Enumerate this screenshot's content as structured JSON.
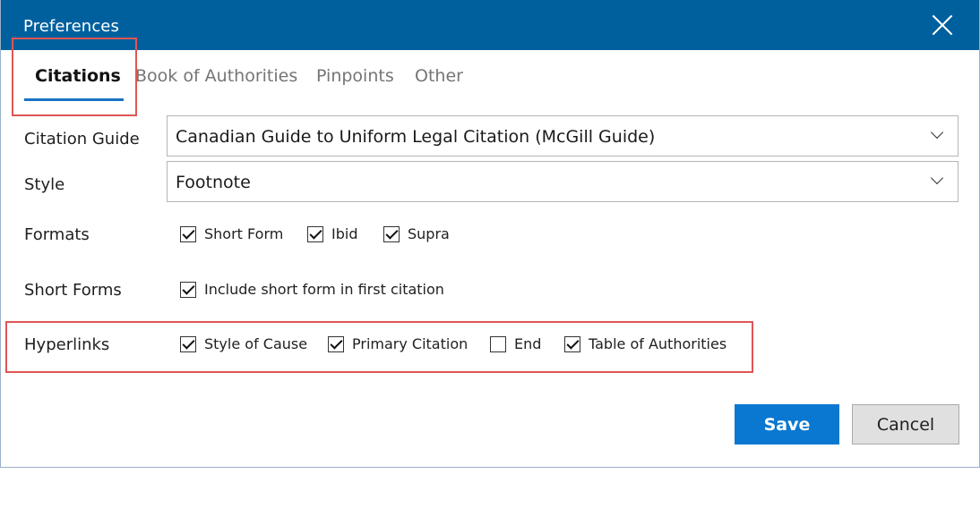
{
  "window": {
    "title": "Preferences"
  },
  "tabs": [
    {
      "label": "Citations",
      "active": true
    },
    {
      "label": "Book of Authorities",
      "active": false
    },
    {
      "label": "Pinpoints",
      "active": false
    },
    {
      "label": "Other",
      "active": false
    }
  ],
  "form": {
    "citation_guide": {
      "label": "Citation Guide",
      "value": "Canadian Guide to Uniform Legal Citation (McGill Guide)"
    },
    "style": {
      "label": "Style",
      "value": "Footnote"
    },
    "formats": {
      "label": "Formats",
      "options": [
        {
          "label": "Short Form",
          "checked": true
        },
        {
          "label": "Ibid",
          "checked": true
        },
        {
          "label": "Supra",
          "checked": true
        }
      ]
    },
    "short_forms": {
      "label": "Short Forms",
      "options": [
        {
          "label": "Include short form in first citation",
          "checked": true
        }
      ]
    },
    "hyperlinks": {
      "label": "Hyperlinks",
      "options": [
        {
          "label": "Style of Cause",
          "checked": true
        },
        {
          "label": "Primary Citation",
          "checked": true
        },
        {
          "label": "End",
          "checked": false
        },
        {
          "label": "Table of Authorities",
          "checked": true
        }
      ]
    }
  },
  "buttons": {
    "save": "Save",
    "cancel": "Cancel"
  },
  "colors": {
    "titlebar": "#00609e",
    "accent": "#0a78d1",
    "highlight": "#e05555"
  }
}
